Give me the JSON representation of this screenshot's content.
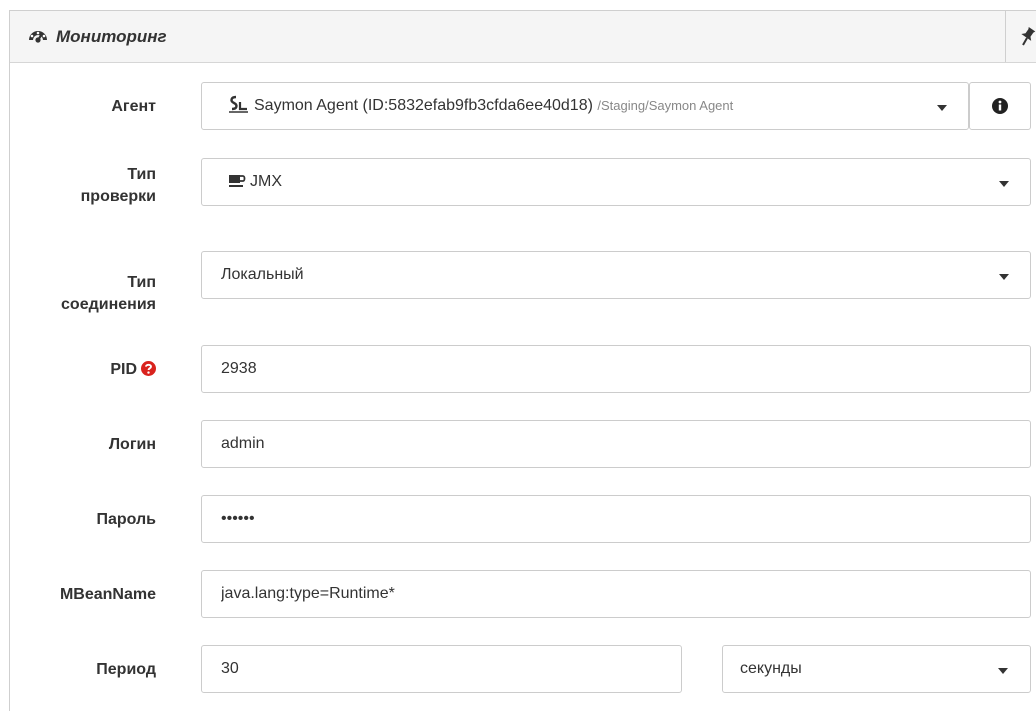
{
  "panel": {
    "title": "Мониторинг",
    "header_icon": "dashboard-icon",
    "pin_icon": "pin-icon"
  },
  "form": {
    "agent": {
      "label": "Агент",
      "value": "Saymon Agent (ID:5832efab9fb3cfda6ee40d18)",
      "path": "/Staging/Saymon Agent",
      "icon": "agent-icon",
      "info_icon": "info-icon"
    },
    "check_type": {
      "label_line1": "Тип",
      "label_line2": "проверки",
      "value": "JMX",
      "icon": "coffee-cup-icon"
    },
    "connection_type": {
      "label_line1": "Тип",
      "label_line2": "соединения",
      "value": "Локальный"
    },
    "pid": {
      "label": "PID",
      "value": "2938",
      "required_icon": "question-circle-icon",
      "required_color": "#d9231e"
    },
    "login": {
      "label": "Логин",
      "value": "admin"
    },
    "password": {
      "label": "Пароль",
      "value": "••••••"
    },
    "mbean": {
      "label": "MBeanName",
      "value": "java.lang:type=Runtime*"
    },
    "period": {
      "label": "Период",
      "value": "30",
      "unit": "секунды"
    }
  }
}
